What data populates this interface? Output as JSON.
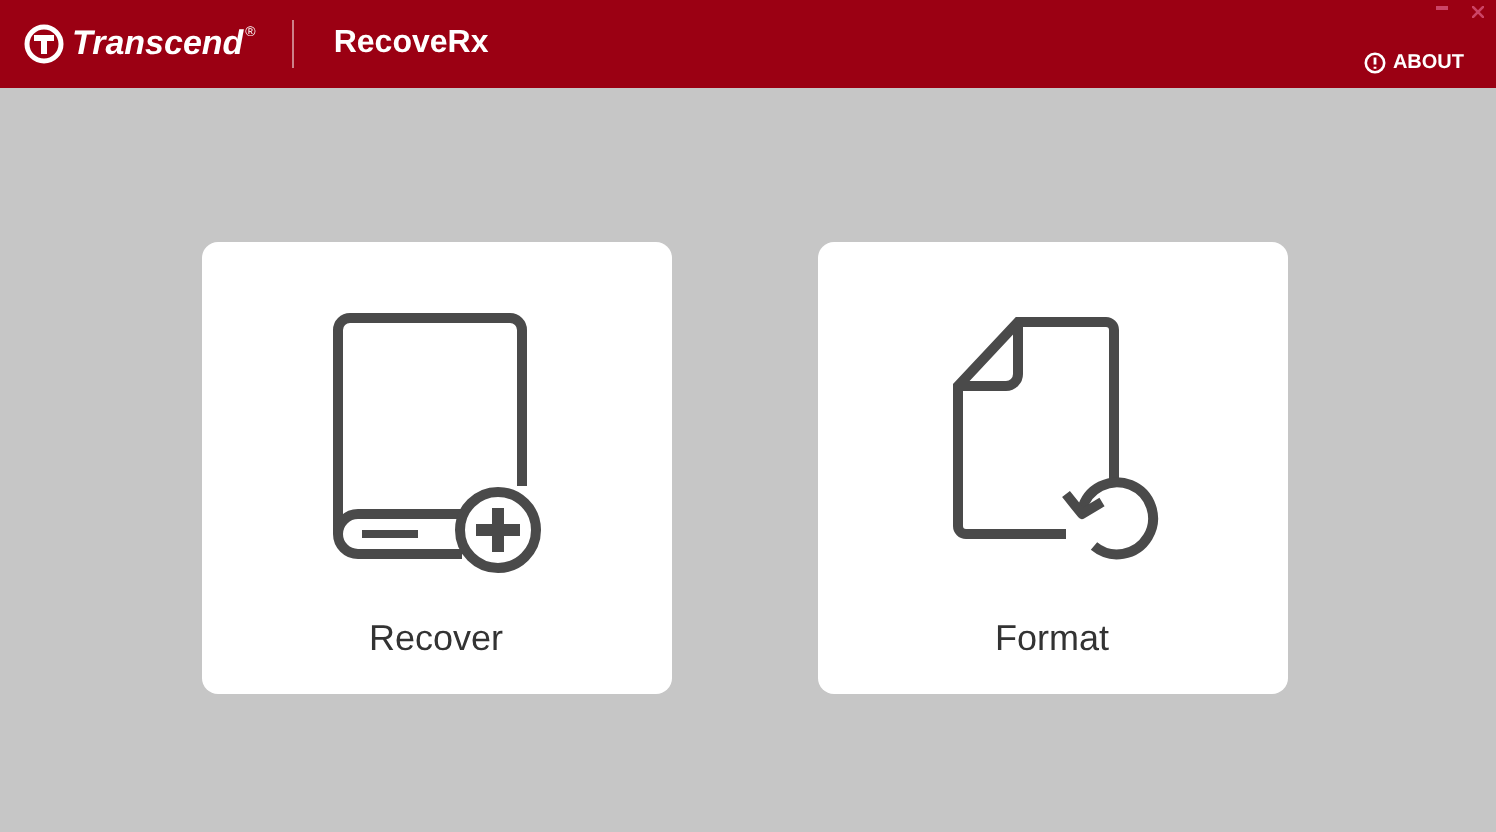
{
  "header": {
    "brand": "Transcend",
    "brand_mark": "®",
    "app_title": "RecoveRx",
    "about": "ABOUT"
  },
  "actions": [
    {
      "kind": "recover",
      "label": "Recover"
    },
    {
      "kind": "format",
      "label": "Format"
    }
  ]
}
